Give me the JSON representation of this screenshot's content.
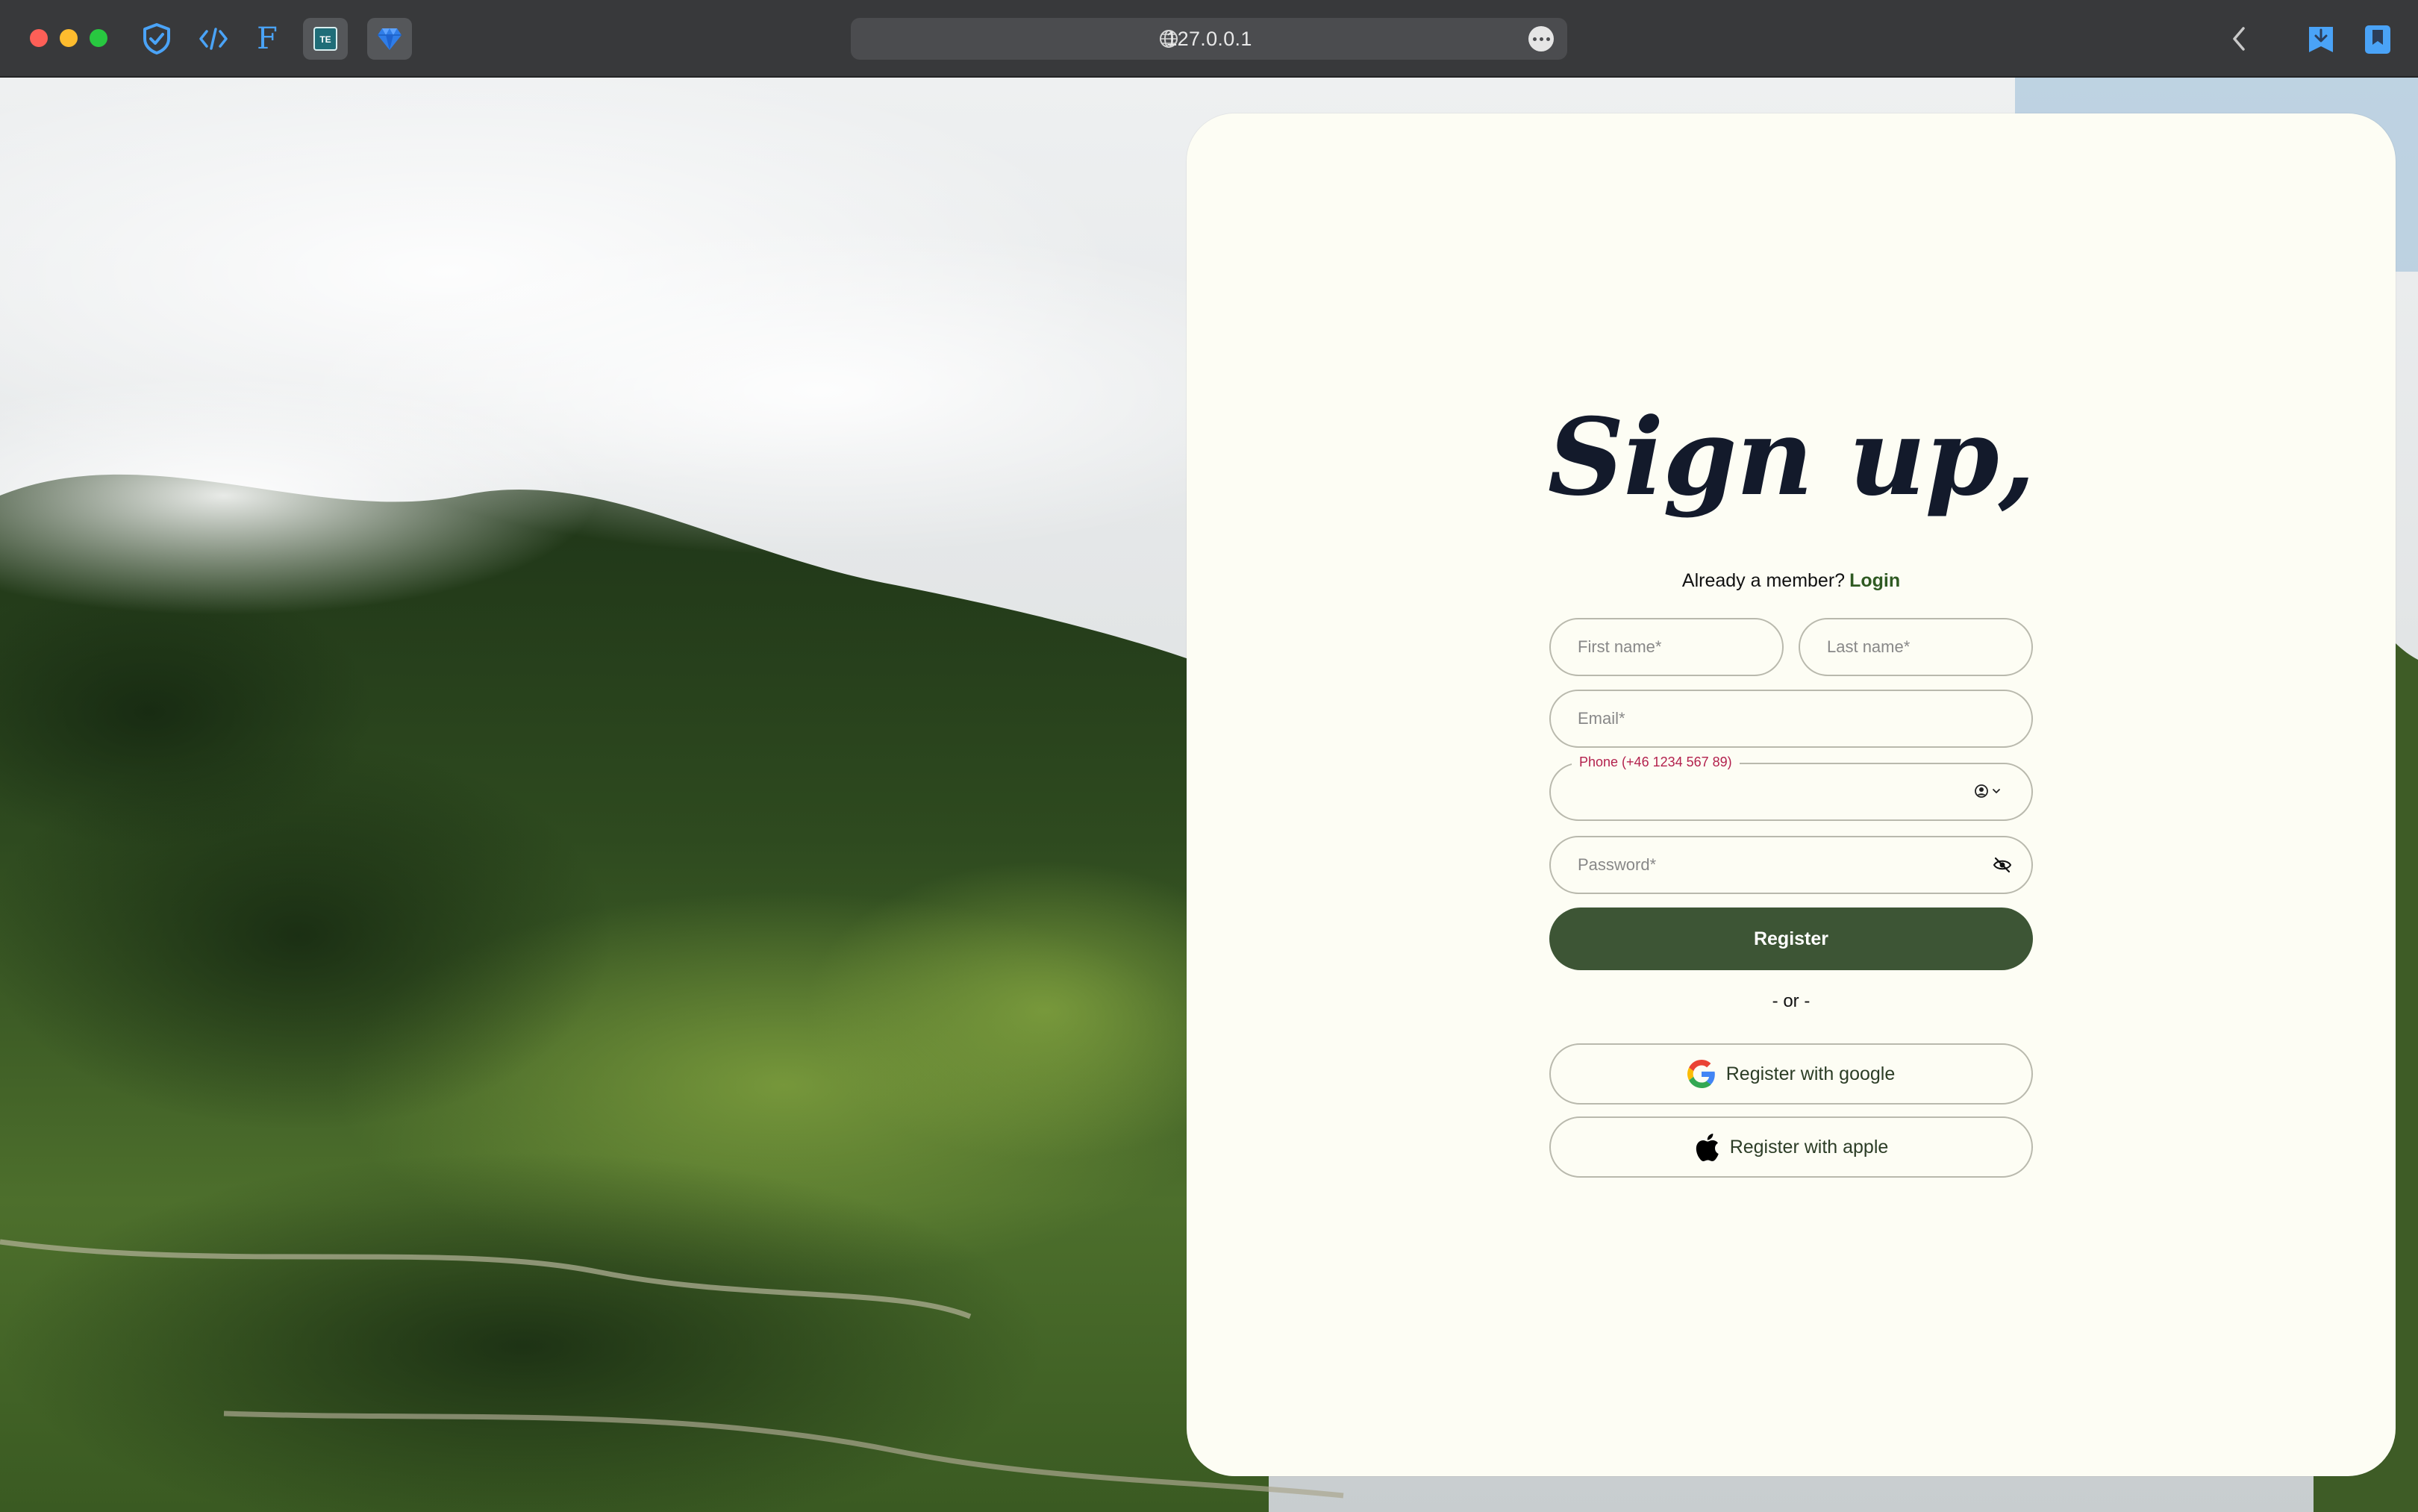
{
  "browser": {
    "url": "127.0.0.1",
    "extensions": [
      "shield-check-icon",
      "code-brackets-icon",
      "font-f-icon",
      "te-icon",
      "gem-icon"
    ],
    "right_icons": [
      "back-chevron-icon",
      "bookmark-download-icon",
      "bookmark-icon"
    ]
  },
  "signup": {
    "title": "Sign up,",
    "already_member": "Already a member?",
    "login_link": "Login",
    "first_name_placeholder": "First name*",
    "last_name_placeholder": "Last name*",
    "email_placeholder": "Email*",
    "phone_label": "Phone (+46 1234 567 89)",
    "password_placeholder": "Password*",
    "register_button": "Register",
    "or_separator": "- or -",
    "google_button": "Register with google",
    "apple_button": "Register with apple"
  },
  "colors": {
    "card_background": "#fdfdf4",
    "primary_button": "#3d5535",
    "login_link": "#2f5a22",
    "phone_label": "#b3214d",
    "heading": "#131a2b"
  }
}
